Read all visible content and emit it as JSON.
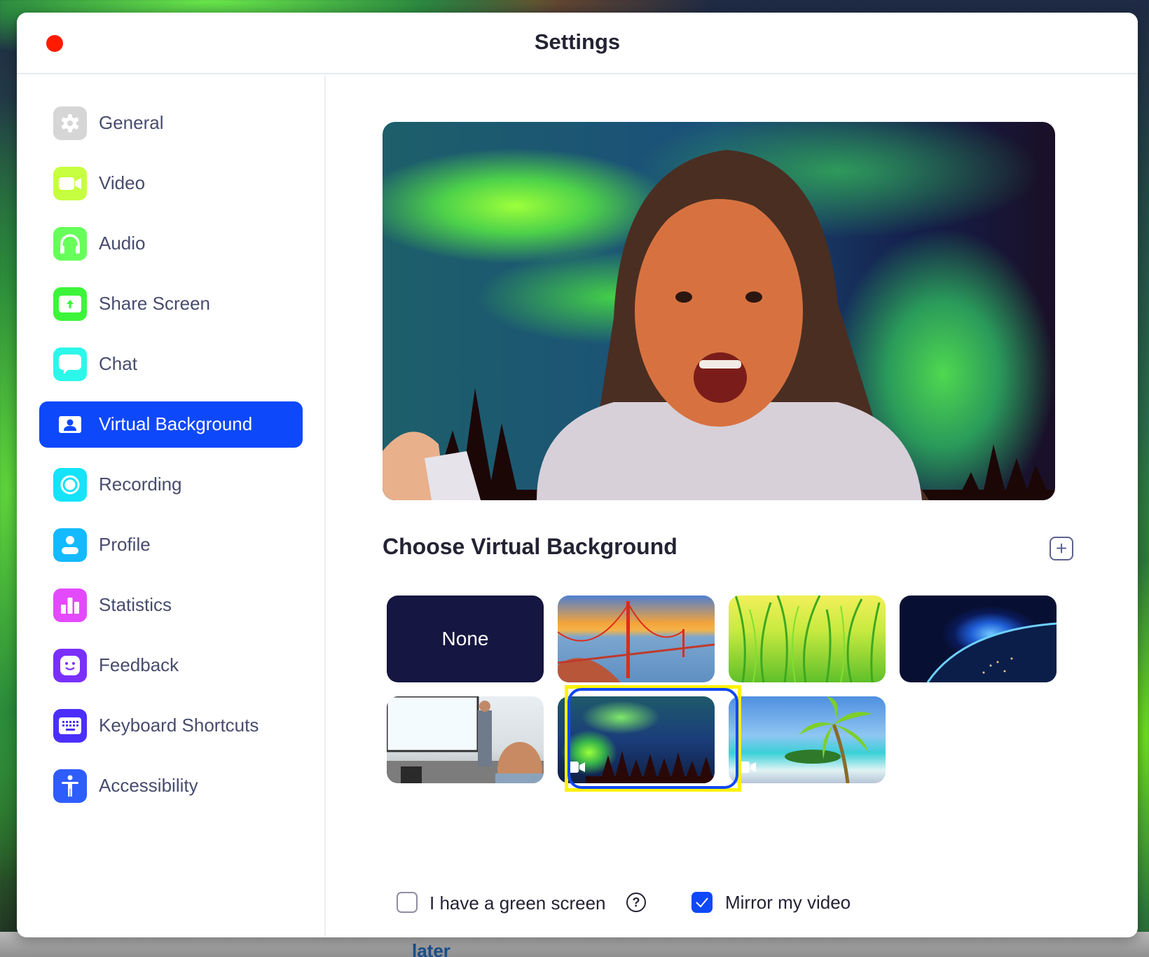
{
  "window": {
    "title": "Settings"
  },
  "sidebar": {
    "items": [
      {
        "label": "General",
        "icon": "gear-icon",
        "color": "#d6d6d6"
      },
      {
        "label": "Video",
        "icon": "video-camera-icon",
        "color": "#c6ff3f"
      },
      {
        "label": "Audio",
        "icon": "headphones-icon",
        "color": "#67ff5a"
      },
      {
        "label": "Share Screen",
        "icon": "share-screen-icon",
        "color": "#3cf53a"
      },
      {
        "label": "Chat",
        "icon": "chat-bubble-icon",
        "color": "#2bf7ea"
      },
      {
        "label": "Virtual Background",
        "icon": "virtual-background-icon",
        "color": "#0e48fb",
        "active": true
      },
      {
        "label": "Recording",
        "icon": "record-icon",
        "color": "#14e3f9"
      },
      {
        "label": "Profile",
        "icon": "profile-icon",
        "color": "#13baff"
      },
      {
        "label": "Statistics",
        "icon": "statistics-icon",
        "color": "#e34afb"
      },
      {
        "label": "Feedback",
        "icon": "feedback-smiley-icon",
        "color": "#7a30fb"
      },
      {
        "label": "Keyboard Shortcuts",
        "icon": "keyboard-icon",
        "color": "#4a2ffb"
      },
      {
        "label": "Accessibility",
        "icon": "accessibility-icon",
        "color": "#2f5dfb"
      }
    ]
  },
  "main": {
    "section_title": "Choose Virtual Background",
    "add_icon": "plus-icon",
    "backgrounds": [
      {
        "name": "None",
        "label": "None",
        "type": "none"
      },
      {
        "name": "Golden Gate Bridge",
        "type": "image"
      },
      {
        "name": "Grass",
        "type": "image"
      },
      {
        "name": "Earth from space",
        "type": "image"
      },
      {
        "name": "Presentation room",
        "type": "image"
      },
      {
        "name": "Northern lights",
        "type": "video",
        "selected": true
      },
      {
        "name": "Tropical beach",
        "type": "video"
      }
    ],
    "green_screen": {
      "label": "I have a green screen",
      "checked": false
    },
    "mirror_video": {
      "label": "Mirror my video",
      "checked": true
    }
  },
  "behind_window": {
    "text": "later"
  },
  "colors": {
    "accent": "#0e48fb",
    "selection_highlight": "#fff200",
    "close_button": "#ff1a00"
  }
}
